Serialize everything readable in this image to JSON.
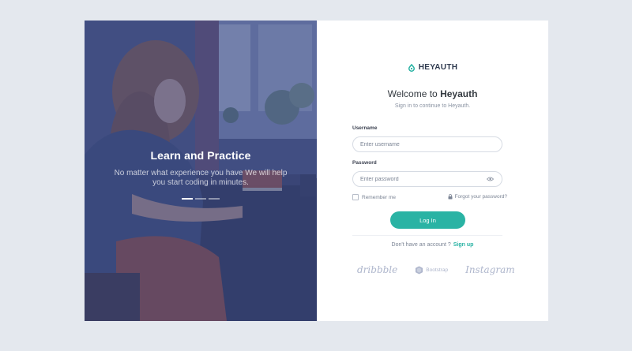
{
  "hero": {
    "title": "Learn and Practice",
    "description": "No matter what experience you have We will help you start coding in minutes.",
    "carousel": {
      "count": 3,
      "active_index": 0
    }
  },
  "brand": {
    "name": "HEYAUTH",
    "accent": "#2ab3a4"
  },
  "form": {
    "welcome_prefix": "Welcome to ",
    "welcome_name": "Heyauth",
    "subtitle": "Sign in to continue to Heyauth.",
    "username": {
      "label": "Username",
      "placeholder": "Enter username",
      "value": ""
    },
    "password": {
      "label": "Password",
      "placeholder": "Enter password",
      "value": ""
    },
    "remember_label": "Remember me",
    "remember_checked": false,
    "forgot_label": "Forgot your password?",
    "login_label": "Log In",
    "signup_prompt": "Don't have an account ?",
    "signup_link": "Sign up"
  },
  "partners": {
    "dribbble": "dribbble",
    "bootstrap": "Bootstrap",
    "instagram": "Instagram"
  },
  "icons": [
    "brand-logo-icon",
    "eye-icon",
    "lock-icon",
    "bootstrap-icon"
  ],
  "colors": {
    "page_bg": "#e4e8ee",
    "overlay": "#3a4882",
    "primary": "#2ab3a4",
    "muted_logo": "#aeb6cc"
  }
}
